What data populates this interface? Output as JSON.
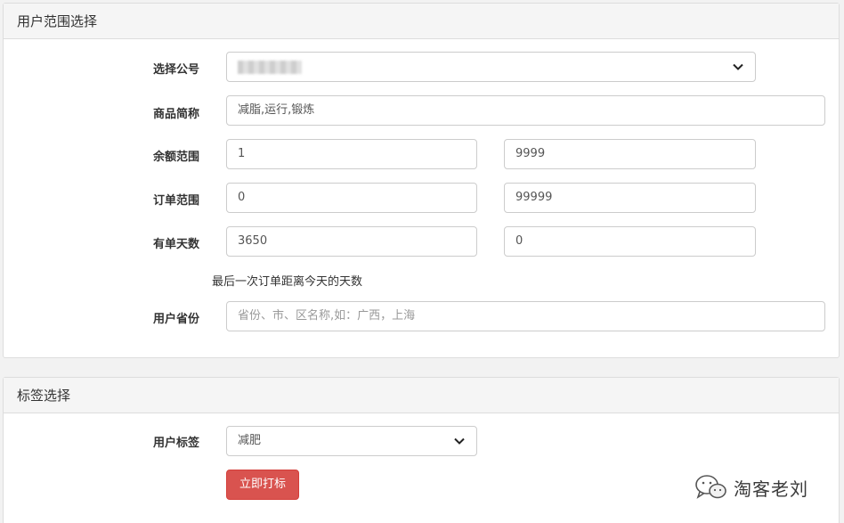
{
  "section1": {
    "title": "用户范围选择",
    "account": {
      "label": "选择公号",
      "value": ""
    },
    "product": {
      "label": "商品简称",
      "value": "减脂,运行,锻炼"
    },
    "balance": {
      "label": "余额范围",
      "min": "1",
      "max": "9999"
    },
    "orders": {
      "label": "订单范围",
      "min": "0",
      "max": "99999"
    },
    "days": {
      "label": "有单天数",
      "min": "3650",
      "max": "0",
      "help": "最后一次订单距离今天的天数"
    },
    "province": {
      "label": "用户省份",
      "placeholder": "省份、市、区名称,如：广西，上海"
    }
  },
  "section2": {
    "title": "标签选择",
    "tag": {
      "label": "用户标签",
      "value": "减肥"
    },
    "submit_label": "立即打标"
  },
  "watermark": {
    "text": "淘客老刘",
    "icon": "wechat-icon"
  },
  "colors": {
    "danger": "#d9534f",
    "panel_heading_bg": "#f5f5f5",
    "border": "#cccccc"
  }
}
